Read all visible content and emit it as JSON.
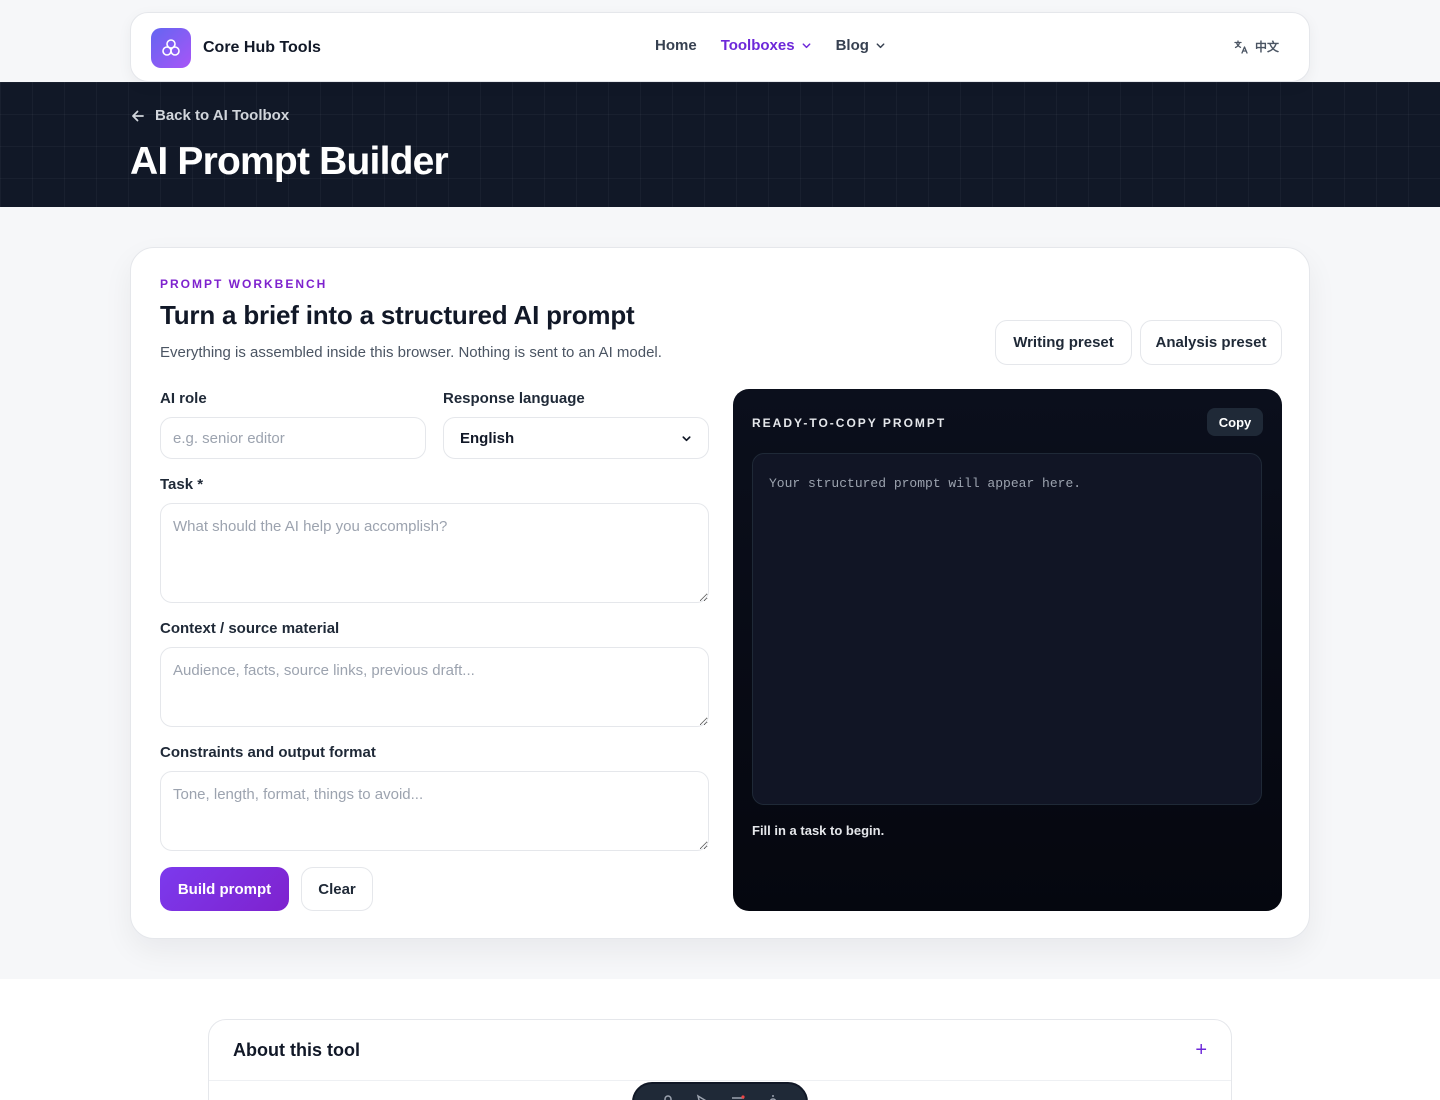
{
  "header": {
    "brand_name": "Core Hub Tools",
    "nav": [
      {
        "label": "Home"
      },
      {
        "label": "Toolboxes"
      },
      {
        "label": "Blog"
      }
    ],
    "language_label": "中文"
  },
  "hero": {
    "back_label": "Back to AI Toolbox",
    "title": "AI Prompt Builder"
  },
  "workbench": {
    "eyebrow": "PROMPT WORKBENCH",
    "title": "Turn a brief into a structured AI prompt",
    "subtitle": "Everything is assembled inside this browser. Nothing is sent to an AI model.",
    "presets": {
      "writing": "Writing preset",
      "analysis": "Analysis preset"
    },
    "fields": {
      "role_label": "AI role",
      "role_placeholder": "e.g. senior editor",
      "role_value": "",
      "language_label": "Response language",
      "language_value": "English",
      "task_label": "Task *",
      "task_placeholder": "What should the AI help you accomplish?",
      "context_label": "Context / source material",
      "context_placeholder": "Audience, facts, source links, previous draft...",
      "constraints_label": "Constraints and output format",
      "constraints_placeholder": "Tone, length, format, things to avoid..."
    },
    "actions": {
      "build": "Build prompt",
      "clear": "Clear"
    },
    "output": {
      "title": "READY-TO-COPY PROMPT",
      "copy": "Copy",
      "placeholder": "Your structured prompt will appear here.",
      "status": "Fill in a task to begin."
    }
  },
  "about": {
    "title": "About this tool",
    "toggle": "+"
  },
  "colors": {
    "accent": "#7e22ce",
    "nav_active": "#6d28d9",
    "hero_bg": "#111827",
    "output_bg": "#05070f"
  },
  "icons": {
    "back": "arrow-left-icon",
    "brand": "hub-logo-icon",
    "chevron": "chevron-down-icon",
    "language": "translate-icon"
  }
}
